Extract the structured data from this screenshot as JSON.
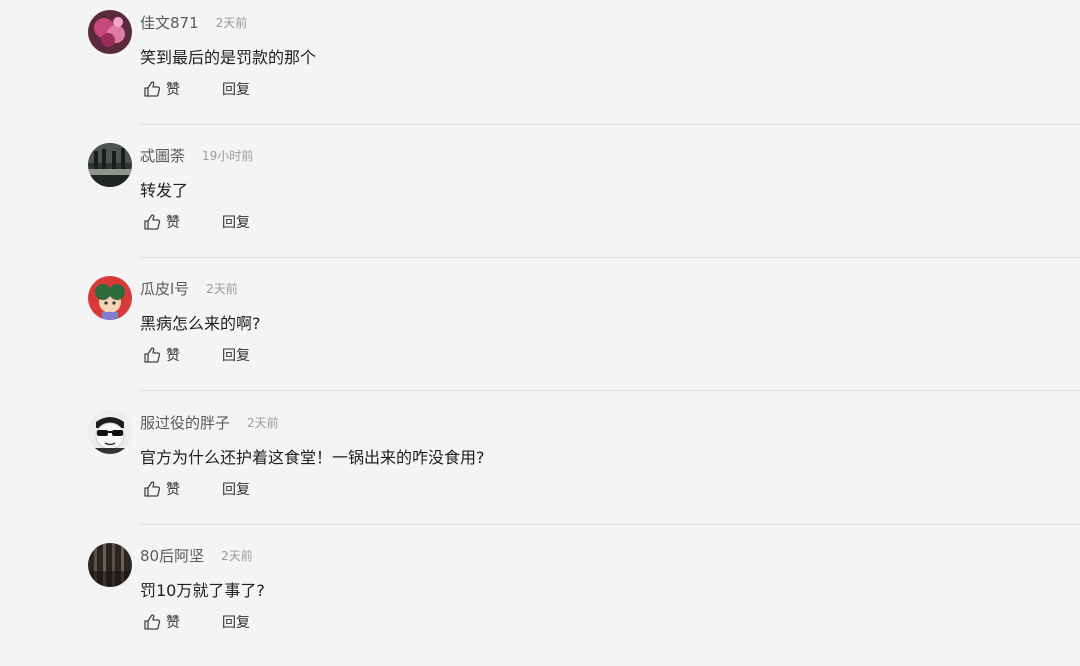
{
  "actions": {
    "like_label": "赞",
    "reply_label": "回复"
  },
  "comments": [
    {
      "username": "佳文871",
      "time": "2天前",
      "text": "笑到最后的是罚款的那个",
      "avatar": "pink-flower-avatar"
    },
    {
      "username": "忒圖荼",
      "time": "19小时前",
      "text": "转发了",
      "avatar": "dark-building-avatar"
    },
    {
      "username": "瓜皮l号",
      "time": "2天前",
      "text": "黑病怎么来的啊?",
      "avatar": "red-cartoon-avatar"
    },
    {
      "username": "服过役的胖子",
      "time": "2天前",
      "text": "官方为什么还护着这食堂！一锅出来的咋没食用?",
      "avatar": "sunglasses-face-avatar"
    },
    {
      "username": "80后阿坚",
      "time": "2天前",
      "text": "罚10万就了事了?",
      "avatar": "dark-striped-avatar"
    }
  ]
}
